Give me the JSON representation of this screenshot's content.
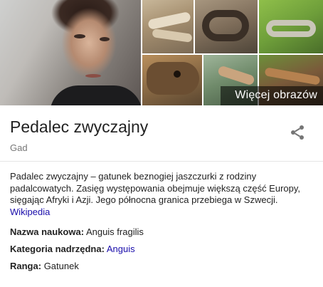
{
  "images": {
    "more_label": "Więcej obrazów",
    "tiles": [
      "portrait",
      "slow-worm-on-sand",
      "slow-worm-coiled",
      "slow-worm-on-grass",
      "slow-worm-head-closeup",
      "slow-worm-on-moss",
      "slow-worm-on-leaves"
    ]
  },
  "header": {
    "title": "Pedalec zwyczajny",
    "subtitle": "Gad",
    "share_icon": "share-icon"
  },
  "description": {
    "text": "Padalec zwyczajny – gatunek beznogiej jaszczurki z rodziny padalcowatych. Zasięg występowania obejmuje większą część Europy, sięgając Afryki i Azji. Jego północna granica przebiega w Szwecji.",
    "source_link": "Wikipedia"
  },
  "facts": [
    {
      "key": "Nazwa naukowa:",
      "value": "Anguis fragilis",
      "is_link": false
    },
    {
      "key": "Kategoria nadrzędna:",
      "value": "Anguis",
      "is_link": true
    },
    {
      "key": "Ranga:",
      "value": "Gatunek",
      "is_link": false
    }
  ],
  "colors": {
    "link": "#1a0dab",
    "subtitle": "#777777",
    "title": "#222222"
  }
}
